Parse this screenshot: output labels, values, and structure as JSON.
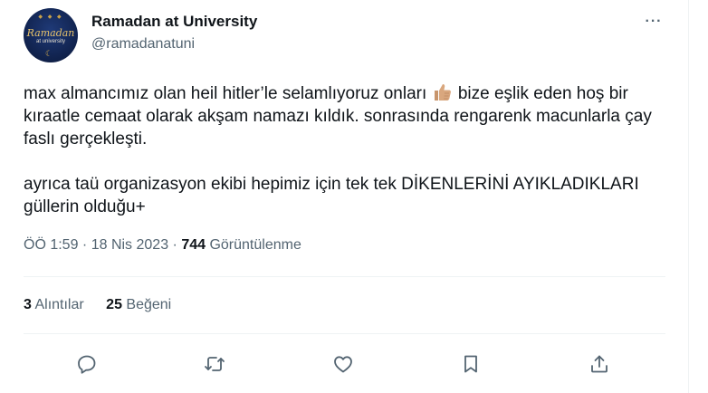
{
  "author": {
    "name": "Ramadan at University",
    "handle": "@ramadanatuni",
    "avatar_text_1": "Ramadan",
    "avatar_text_2": "at university"
  },
  "tweet": {
    "line1_before": "max almancımız olan heil hitler’le selamlıyoruz onları ",
    "line1_after": " bize eşlik eden hoş bir kıraatle cemaat olarak akşam namazı kıldık. sonrasında rengarenk macunlarla çay faslı gerçekleşti.",
    "paragraph2": "ayrıca taü organizasyon ekibi hepimiz için tek tek DİKENLERİNİ AYIKLADIKLARI güllerin olduğu+",
    "emoji": "thumbs-up-icon"
  },
  "meta": {
    "time": "ÖÖ 1:59",
    "sep1": " · ",
    "date": "18 Nis 2023",
    "sep2": " · ",
    "views_count": "744",
    "views_label": " Görüntülenme"
  },
  "stats": {
    "quotes_count": "3",
    "quotes_label": " Alıntılar",
    "likes_count": "25",
    "likes_label": " Beğeni"
  },
  "colors": {
    "text": "#0f1419",
    "secondary": "#536471",
    "divider": "#eff3f4"
  }
}
